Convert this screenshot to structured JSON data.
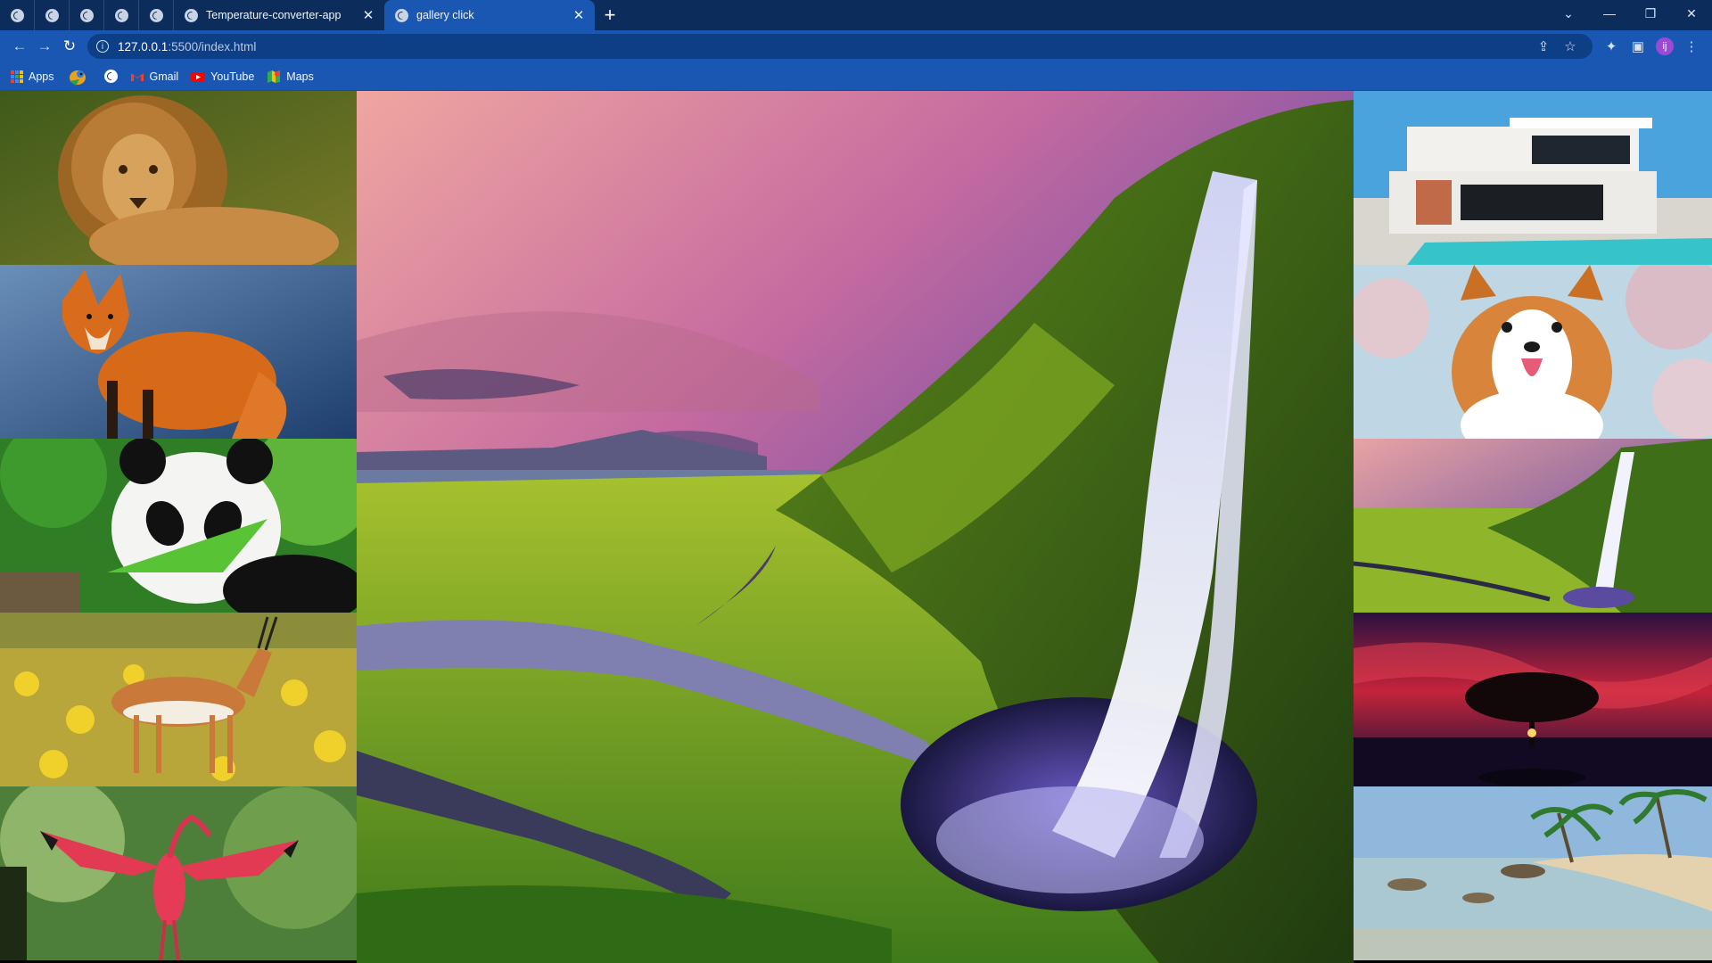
{
  "browser": {
    "tabs": [
      {
        "label": "Temperature-converter-app",
        "active": false
      },
      {
        "label": "gallery click",
        "active": true
      }
    ],
    "pinned_tab_count": 5,
    "address": {
      "host": "127.0.0.1",
      "rest": ":5500/index.html"
    },
    "profile_initial": "ij",
    "bookmarks": [
      {
        "label": "Apps",
        "icon": "apps-grid-icon"
      },
      {
        "label": "",
        "icon": "bird-icon"
      },
      {
        "label": "",
        "icon": "globe-icon"
      },
      {
        "label": "Gmail",
        "icon": "gmail-icon"
      },
      {
        "label": "YouTube",
        "icon": "youtube-icon"
      },
      {
        "label": "Maps",
        "icon": "maps-icon"
      }
    ]
  },
  "gallery": {
    "left": [
      "lion",
      "fox",
      "panda",
      "gazelle",
      "scarlet ibis"
    ],
    "main": "waterfall landscape",
    "right": [
      "modern house",
      "corgi dog",
      "waterfall landscape",
      "tree at sunset",
      "tropical beach"
    ]
  },
  "colors": {
    "titlebar": "#0c2d5c",
    "toolbar": "#1a57b2",
    "omnibox": "#0d3f86"
  }
}
